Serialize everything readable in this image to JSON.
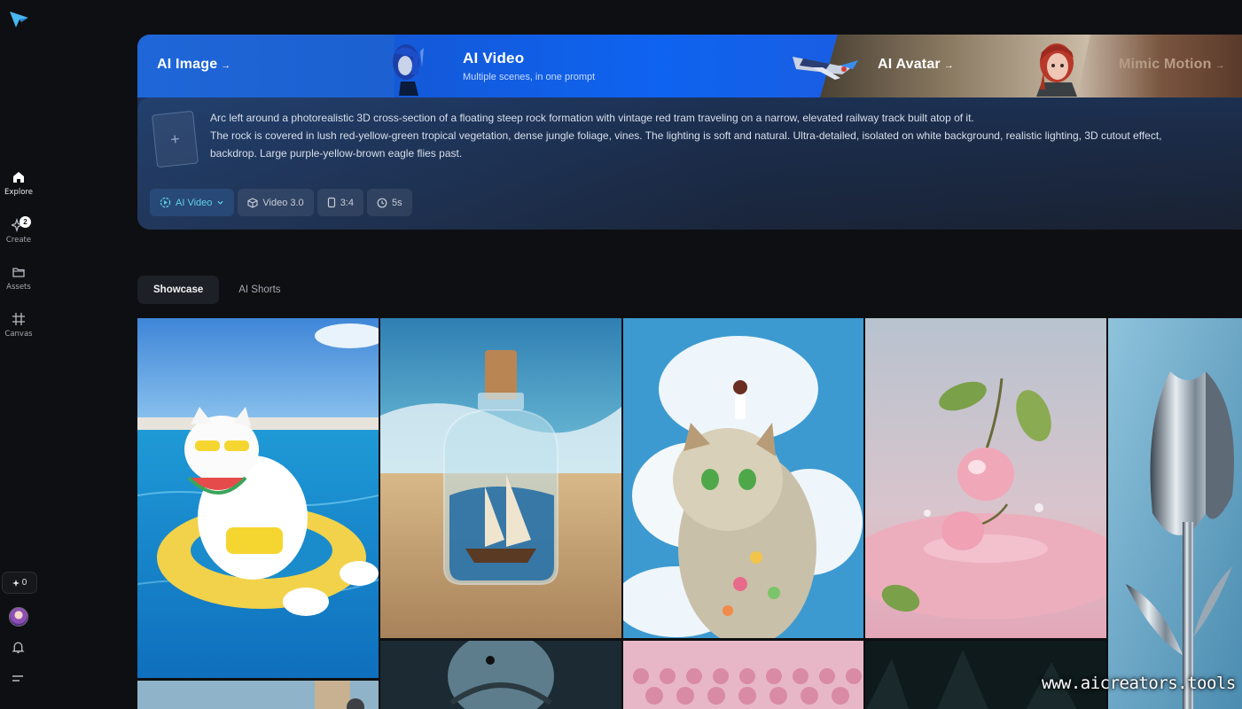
{
  "sidebar": {
    "items": [
      {
        "label": "Explore",
        "icon": "home-icon"
      },
      {
        "label": "Create",
        "icon": "sparkle-icon",
        "badge": "2"
      },
      {
        "label": "Assets",
        "icon": "folder-icon"
      },
      {
        "label": "Canvas",
        "icon": "canvas-icon"
      }
    ],
    "credits": "0"
  },
  "banner": {
    "tabs": [
      {
        "title": "AI Image"
      },
      {
        "title": "AI Video",
        "subtitle": "Multiple scenes, in one prompt"
      },
      {
        "title": "AI Avatar"
      },
      {
        "title": "Mimic Motion"
      }
    ],
    "prompt_lines": [
      "Arc left around a photorealistic 3D cross-section of a floating steep rock formation with vintage red tram traveling on a narrow, elevated railway track built atop of it.",
      "The rock is covered in lush red-yellow-green tropical vegetation, dense jungle foliage, vines. The lighting is soft and natural. Ultra-detailed, isolated on white background, realistic lighting, 3D cutout effect,",
      "backdrop. Large purple-yellow-brown eagle flies past."
    ],
    "upload_symbol": "+",
    "chips": [
      {
        "label": "AI Video",
        "icon": "video-mode-icon"
      },
      {
        "label": "Video 3.0",
        "icon": "cube-icon"
      },
      {
        "label": "3:4",
        "icon": "ratio-icon"
      },
      {
        "label": "5s",
        "icon": "clock-icon"
      }
    ]
  },
  "section_tabs": [
    "Showcase",
    "AI Shorts"
  ],
  "watermark": "www.aicreators.tools",
  "colors": {
    "accent": "#1b63ee",
    "chip_active_text": "#5fd1e8",
    "background": "#0e0f12"
  }
}
